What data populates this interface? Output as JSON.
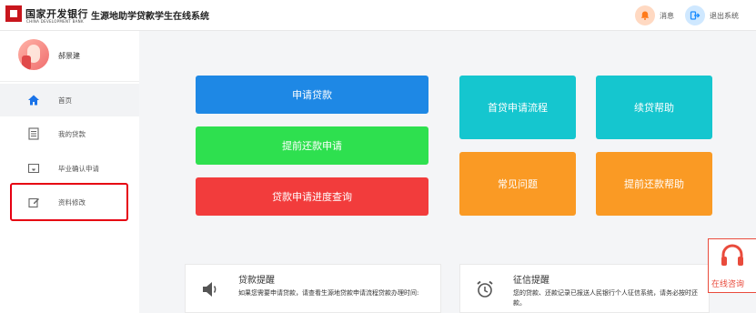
{
  "header": {
    "brand_cn": "国家开发银行",
    "brand_en": "CHINA DEVELOPMENT BANK",
    "system_title": "生源地助学贷款学生在线系统",
    "messages_label": "消息",
    "logout_label": "退出系统"
  },
  "sidebar": {
    "user_name": "郝景建",
    "items": [
      {
        "label": "首页",
        "icon": "home-icon"
      },
      {
        "label": "我的贷款",
        "icon": "document-icon"
      },
      {
        "label": "毕业确认申请",
        "icon": "inbox-icon"
      },
      {
        "label": "资料修改",
        "icon": "edit-icon"
      }
    ]
  },
  "actions": {
    "apply": "申请贷款",
    "prepay_apply": "提前还款申请",
    "progress_query": "贷款申请进度查询",
    "first_loan_process": "首贷申请流程",
    "renewal_help": "续贷帮助",
    "faq": "常见问题",
    "prepay_help": "提前还款帮助"
  },
  "cards": {
    "loan_reminder": {
      "title": "贷款提醒",
      "desc": "如果您需要申请贷款，请查看生源地贷款申请流程贷款办理时间:"
    },
    "credit_reminder": {
      "title": "征信提醒",
      "desc": "您的贷款、还款记录已报送人民银行个人征信系统，请务必按时还款。"
    }
  },
  "consult": {
    "label": "在线咨询"
  },
  "colors": {
    "primary_blue": "#1e88e5",
    "green": "#2ee04f",
    "red": "#f23c3c",
    "teal": "#15c6cf",
    "orange": "#fa9a24",
    "highlight": "#e60012"
  }
}
